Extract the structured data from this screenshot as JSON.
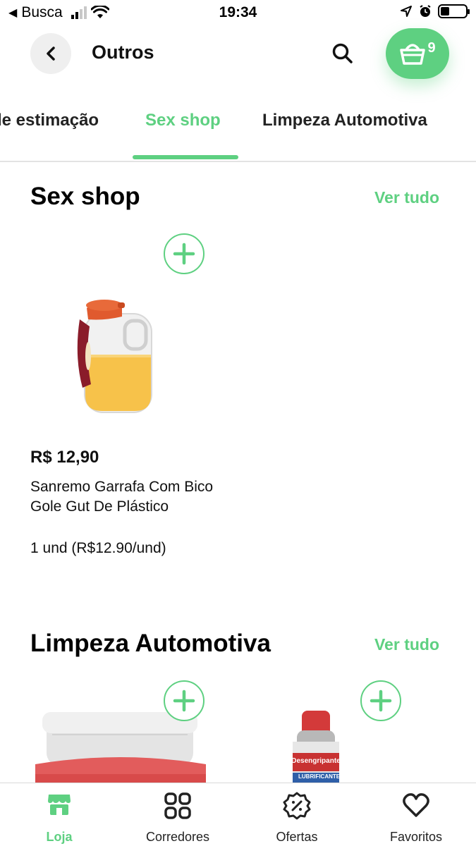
{
  "status_bar": {
    "carrier": "Busca",
    "time": "19:34"
  },
  "header": {
    "title": "Outros",
    "cart_count": "9"
  },
  "tabs": [
    {
      "label": "le estimação",
      "active": false
    },
    {
      "label": "Sex shop",
      "active": true
    },
    {
      "label": "Limpeza Automotiva",
      "active": false
    }
  ],
  "sections": [
    {
      "title": "Sex shop",
      "see_all": "Ver tudo",
      "products": [
        {
          "price": "R$ 12,90",
          "name": "Sanremo Garrafa Com Bico Gole Gut De Plástico",
          "unit": "1 und (R$12.90/und)"
        }
      ]
    },
    {
      "title": "Limpeza Automotiva",
      "see_all": "Ver tudo",
      "products": [
        {
          "label_1": "",
          "label_2": ""
        },
        {
          "label_1": "Desengripante",
          "label_2": "LUBRIFICANTE"
        }
      ]
    }
  ],
  "bottom_nav": [
    {
      "label": "Loja",
      "icon": "store-icon",
      "active": true
    },
    {
      "label": "Corredores",
      "icon": "grid-icon",
      "active": false
    },
    {
      "label": "Ofertas",
      "icon": "discount-badge-icon",
      "active": false
    },
    {
      "label": "Favoritos",
      "icon": "heart-icon",
      "active": false
    }
  ],
  "colors": {
    "accent": "#5ed081",
    "text": "#111111"
  }
}
